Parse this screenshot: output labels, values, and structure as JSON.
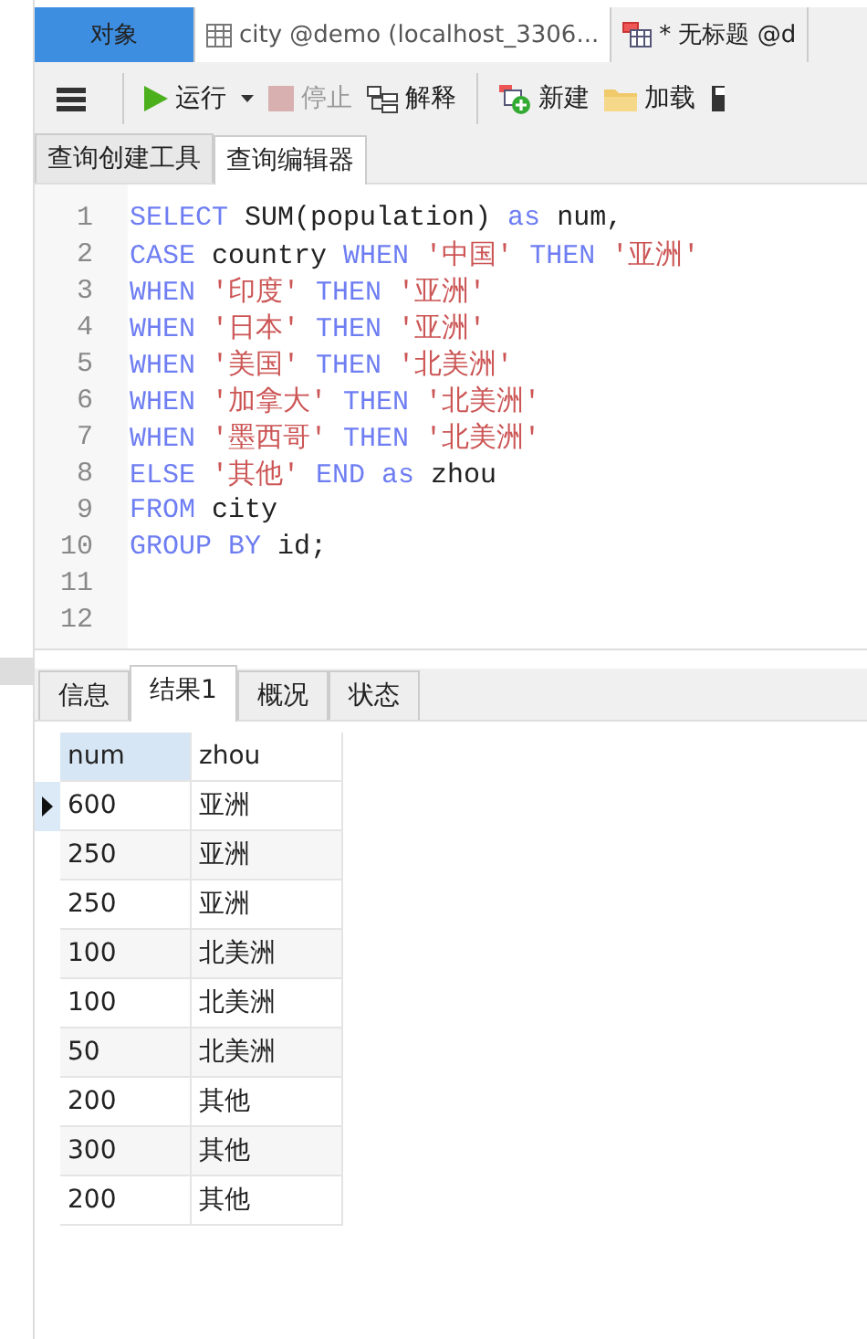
{
  "window_tabs": [
    {
      "label": "对象",
      "selected": true,
      "kind": "plain"
    },
    {
      "label": "city @demo (localhost_3306...",
      "selected": false,
      "kind": "table"
    },
    {
      "label": "* 无标题 @d",
      "selected": false,
      "kind": "query"
    }
  ],
  "toolbar": [
    {
      "kind": "menu"
    },
    {
      "kind": "run",
      "label": "运行",
      "disabled": false
    },
    {
      "kind": "stop",
      "label": "停止",
      "disabled": true
    },
    {
      "kind": "explain",
      "label": "解释",
      "disabled": false
    },
    {
      "kind": "new",
      "label": "新建",
      "disabled": false
    },
    {
      "kind": "load",
      "label": "加载",
      "disabled": false
    },
    {
      "kind": "save"
    }
  ],
  "editor_tabs": [
    {
      "label": "查询创建工具",
      "selected": false
    },
    {
      "label": "查询编辑器",
      "selected": true
    }
  ],
  "code_lines": [
    {
      "number": "1",
      "tokens": [
        {
          "kind": "keyword",
          "text": "SELECT"
        },
        {
          "kind": "ident",
          "text": " SUM(population) "
        },
        {
          "kind": "keyword",
          "text": "as"
        },
        {
          "kind": "ident",
          "text": " num,"
        }
      ]
    },
    {
      "number": "2",
      "tokens": [
        {
          "kind": "keyword",
          "text": "CASE"
        },
        {
          "kind": "ident",
          "text": " country "
        },
        {
          "kind": "keyword",
          "text": "WHEN"
        },
        {
          "kind": "string",
          "text": " '中国' "
        },
        {
          "kind": "keyword",
          "text": "THEN"
        },
        {
          "kind": "string",
          "text": " '亚洲'"
        }
      ]
    },
    {
      "number": "3",
      "tokens": [
        {
          "kind": "keyword",
          "text": "WHEN"
        },
        {
          "kind": "string",
          "text": " '印度' "
        },
        {
          "kind": "keyword",
          "text": "THEN"
        },
        {
          "kind": "string",
          "text": " '亚洲'"
        }
      ]
    },
    {
      "number": "4",
      "tokens": [
        {
          "kind": "keyword",
          "text": "WHEN"
        },
        {
          "kind": "string",
          "text": " '日本' "
        },
        {
          "kind": "keyword",
          "text": "THEN"
        },
        {
          "kind": "string",
          "text": " '亚洲'"
        }
      ]
    },
    {
      "number": "5",
      "tokens": [
        {
          "kind": "keyword",
          "text": "WHEN"
        },
        {
          "kind": "string",
          "text": " '美国' "
        },
        {
          "kind": "keyword",
          "text": "THEN"
        },
        {
          "kind": "string",
          "text": " '北美洲'"
        }
      ]
    },
    {
      "number": "6",
      "tokens": [
        {
          "kind": "keyword",
          "text": "WHEN"
        },
        {
          "kind": "string",
          "text": " '加拿大' "
        },
        {
          "kind": "keyword",
          "text": "THEN"
        },
        {
          "kind": "string",
          "text": " '北美洲'"
        }
      ]
    },
    {
      "number": "7",
      "tokens": [
        {
          "kind": "keyword",
          "text": "WHEN"
        },
        {
          "kind": "string",
          "text": " '墨西哥' "
        },
        {
          "kind": "keyword",
          "text": "THEN"
        },
        {
          "kind": "string",
          "text": " '北美洲'"
        }
      ]
    },
    {
      "number": "8",
      "tokens": [
        {
          "kind": "keyword",
          "text": "ELSE"
        },
        {
          "kind": "string",
          "text": " '其他' "
        },
        {
          "kind": "keyword",
          "text": "END as"
        },
        {
          "kind": "ident",
          "text": " zhou"
        }
      ]
    },
    {
      "number": "9",
      "tokens": [
        {
          "kind": "keyword",
          "text": "FROM"
        },
        {
          "kind": "ident",
          "text": " city"
        }
      ]
    },
    {
      "number": "10",
      "tokens": [
        {
          "kind": "keyword",
          "text": "GROUP BY"
        },
        {
          "kind": "ident",
          "text": " id;"
        }
      ]
    },
    {
      "number": "11"
    },
    {
      "number": "12"
    }
  ],
  "result_tabs": [
    {
      "label": "信息",
      "selected": false
    },
    {
      "label": "结果1",
      "selected": true
    },
    {
      "label": "概况",
      "selected": false
    },
    {
      "label": "状态",
      "selected": false
    }
  ],
  "table": {
    "columns": [
      "num",
      "zhou"
    ],
    "rows": [
      {
        "cells": [
          "600",
          "亚洲"
        ],
        "selected": true
      },
      {
        "cells": [
          "250",
          "亚洲"
        ],
        "selected": false
      },
      {
        "cells": [
          "250",
          "亚洲"
        ],
        "selected": false
      },
      {
        "cells": [
          "100",
          "北美洲"
        ],
        "selected": false
      },
      {
        "cells": [
          "100",
          "北美洲"
        ],
        "selected": false
      },
      {
        "cells": [
          "50",
          "北美洲"
        ],
        "selected": false
      },
      {
        "cells": [
          "200",
          "其他"
        ],
        "selected": false
      },
      {
        "cells": [
          "300",
          "其他"
        ],
        "selected": false
      },
      {
        "cells": [
          "200",
          "其他"
        ],
        "selected": false
      }
    ]
  }
}
